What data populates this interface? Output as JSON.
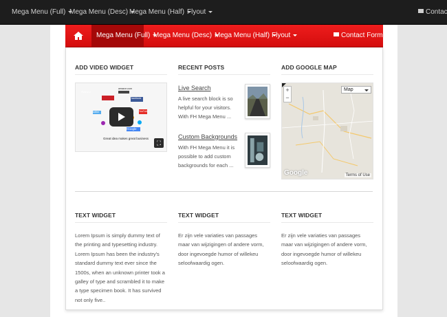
{
  "top_nav": {
    "items": [
      "Mega Menu (Full)",
      "Mega Menu (Desc)",
      "Mega Menu (Half)",
      "Flyout"
    ],
    "contact": "Contact F"
  },
  "main_nav": {
    "items": [
      "Mega Menu (Full)",
      "Mega Menu (Desc)",
      "Mega Menu (Half)",
      "Flyout"
    ],
    "contact": "Contact Form",
    "active_color": "#a40808",
    "bar_color": "#e31515"
  },
  "widgets": {
    "video": {
      "title": "ADD VIDEO WIDGET",
      "caption": "Great idea makes great business",
      "labels": [
        "Pinterest",
        "amazon.com",
        "facebook",
        "YouTube",
        "twitter",
        "Google"
      ]
    },
    "posts": {
      "title": "RECENT POSTS",
      "items": [
        {
          "title": "Live Search",
          "excerpt": "A live search block is so helpful for your visitors. With FH Mega Menu ..."
        },
        {
          "title": "Custom Backgrounds",
          "excerpt": "With FH Mega Menu it is possible to add custom backgrounds for each ..."
        }
      ]
    },
    "map": {
      "title": "ADD GOOGLE MAP",
      "type": "Map",
      "logo": "Google",
      "terms": "Terms of Use"
    },
    "text1": {
      "title": "TEXT WIDGET",
      "body": "Lorem Ipsum is simply dummy text of the printing and typesetting industry. Lorem Ipsum has been the industry's standard dummy text ever since the 1500s, when an unknown printer took a galley of type and scrambled it to make a type specimen book. It has survived not only five.."
    },
    "text2": {
      "title": "TEXT WIDGET",
      "body": "Er zijn vele variaties van passages maar van wijzigingen of andere vorm, door ingevoegde humor of willekeu seloofwaardig ogen."
    },
    "text3": {
      "title": "TEXT WIDGET",
      "body": "Er zijn vele variaties van passages maar van wijzigingen of andere vorm, door ingevoegde humor of willekeu seloofwaardig ogen."
    }
  }
}
